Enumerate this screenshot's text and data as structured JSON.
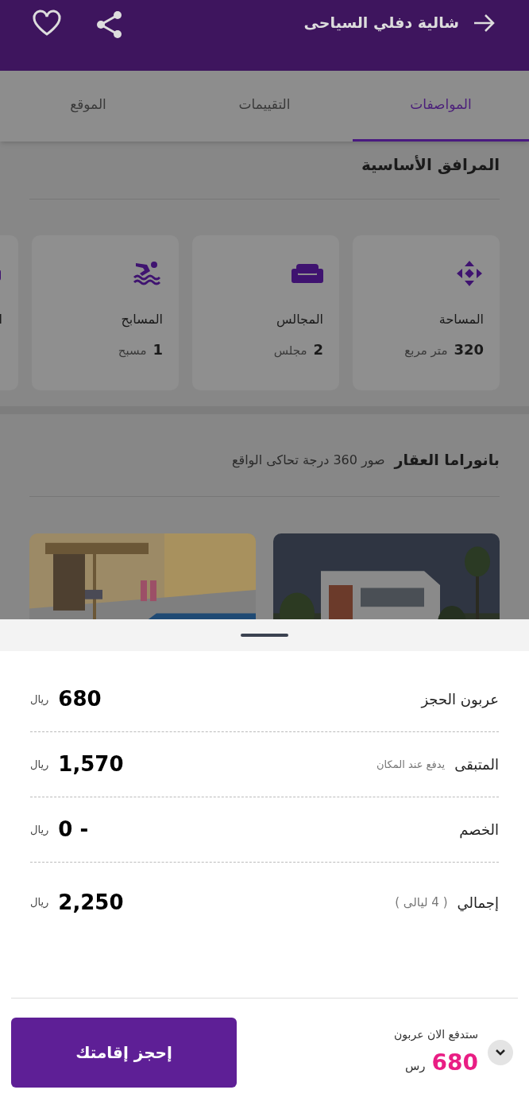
{
  "header": {
    "title": "شالية دفلي السياحى"
  },
  "tabs": [
    {
      "label": "المواصفات",
      "selected": true
    },
    {
      "label": "التقييمات",
      "selected": false
    },
    {
      "label": "الموقع",
      "selected": false
    }
  ],
  "facilities": {
    "title": "المرافق الأساسية",
    "items": [
      {
        "kind": "area",
        "label": "المساحة",
        "value": "320",
        "unit": "متر مربع"
      },
      {
        "kind": "seating",
        "label": "المجالس",
        "value": "2",
        "unit": "مجلس"
      },
      {
        "kind": "pool",
        "label": "المسابح",
        "value": "1",
        "unit": "مسبح"
      },
      {
        "kind": "other",
        "label": "ا"
      }
    ]
  },
  "panorama": {
    "title": "بانوراما العقار",
    "subtitle": "صور 360 درجة تحاكى الواقع"
  },
  "pricing": {
    "rows": [
      {
        "label": "عربون الحجز",
        "amount": "680",
        "currency": "ريال"
      },
      {
        "label": "المتبقى",
        "note": "يدفع عند المكان",
        "amount": "1,570",
        "currency": "ريال"
      },
      {
        "label": "الخصم",
        "amount": "- 0",
        "currency": "ريال"
      },
      {
        "label": "إجمالي",
        "note": "( 4 ليالى )",
        "amount": "2,250",
        "currency": "ريال"
      }
    ]
  },
  "footer": {
    "caption": "ستدفع الان عربون",
    "amount": "680",
    "currency": "رس",
    "book_button": "إحجز إقامتك"
  }
}
